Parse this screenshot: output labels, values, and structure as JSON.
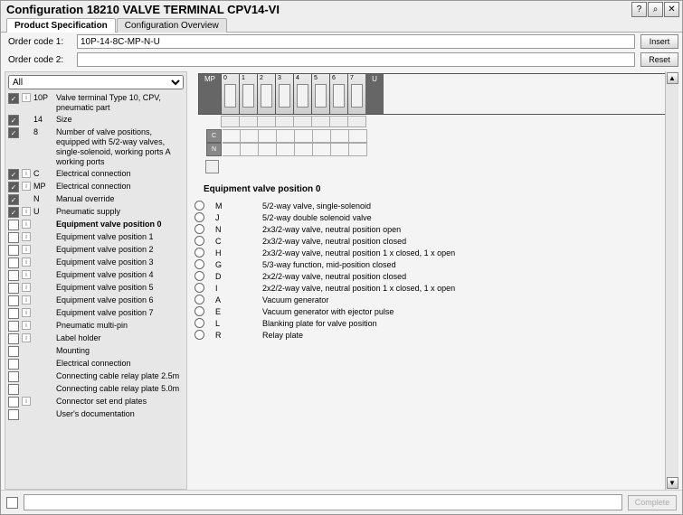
{
  "title": "Configuration 18210 VALVE TERMINAL CPV14-VI",
  "tabs": [
    "Product Specification",
    "Configuration Overview"
  ],
  "orderCode1Label": "Order code 1:",
  "orderCode1Value": "10P-14-8C-MP-N-U",
  "orderCode2Label": "Order code 2:",
  "insert": "Insert",
  "reset": "Reset",
  "filter": "All",
  "config": [
    {
      "ck": true,
      "info": true,
      "code": "10P",
      "lbl": "Valve terminal Type 10, CPV, pneumatic part"
    },
    {
      "ck": true,
      "info": false,
      "code": "14",
      "lbl": "Size"
    },
    {
      "ck": true,
      "info": false,
      "code": "8",
      "lbl": "Number of valve positions, equipped with 5/2-way valves, single-solenoid, working ports A working ports"
    },
    {
      "ck": true,
      "info": true,
      "code": "C",
      "lbl": "Electrical connection"
    },
    {
      "ck": true,
      "info": true,
      "code": "MP",
      "lbl": "Electrical connection"
    },
    {
      "ck": true,
      "info": false,
      "code": "N",
      "lbl": "Manual override"
    },
    {
      "ck": true,
      "info": true,
      "code": "U",
      "lbl": "Pneumatic supply"
    },
    {
      "ck": false,
      "info": true,
      "code": "",
      "lbl": "Equipment valve position 0",
      "bold": true
    },
    {
      "ck": false,
      "info": true,
      "code": "",
      "lbl": "Equipment valve position 1"
    },
    {
      "ck": false,
      "info": true,
      "code": "",
      "lbl": "Equipment valve position 2"
    },
    {
      "ck": false,
      "info": true,
      "code": "",
      "lbl": "Equipment valve position 3"
    },
    {
      "ck": false,
      "info": true,
      "code": "",
      "lbl": "Equipment valve position 4"
    },
    {
      "ck": false,
      "info": true,
      "code": "",
      "lbl": "Equipment valve position 5"
    },
    {
      "ck": false,
      "info": true,
      "code": "",
      "lbl": "Equipment valve position 6"
    },
    {
      "ck": false,
      "info": true,
      "code": "",
      "lbl": "Equipment valve position 7"
    },
    {
      "ck": false,
      "info": true,
      "code": "",
      "lbl": "Pneumatic multi-pin"
    },
    {
      "ck": false,
      "info": true,
      "code": "",
      "lbl": "Label holder"
    },
    {
      "ck": false,
      "info": false,
      "code": "",
      "lbl": "Mounting"
    },
    {
      "ck": false,
      "info": false,
      "code": "",
      "lbl": "Electrical connection"
    },
    {
      "ck": false,
      "info": false,
      "code": "",
      "lbl": "Connecting cable relay plate 2.5m"
    },
    {
      "ck": false,
      "info": false,
      "code": "",
      "lbl": "Connecting cable relay plate 5.0m"
    },
    {
      "ck": false,
      "info": true,
      "code": "",
      "lbl": "Connector set end plates"
    },
    {
      "ck": false,
      "info": false,
      "code": "",
      "lbl": "User's documentation"
    }
  ],
  "slots": [
    "0",
    "1",
    "2",
    "3",
    "4",
    "5",
    "6",
    "7"
  ],
  "mpLabel": "MP",
  "uLabel": "U",
  "cLabel": "C",
  "nLabel": "N",
  "sectionTitle": "Equipment valve position 0",
  "options": [
    {
      "code": "M",
      "desc": "5/2-way valve, single-solenoid"
    },
    {
      "code": "J",
      "desc": "5/2-way double solenoid valve"
    },
    {
      "code": "N",
      "desc": "2x3/2-way valve, neutral position open"
    },
    {
      "code": "C",
      "desc": "2x3/2-way valve, neutral position closed"
    },
    {
      "code": "H",
      "desc": "2x3/2-way valve, neutral position 1 x closed, 1 x open"
    },
    {
      "code": "G",
      "desc": "5/3-way function, mid-position closed"
    },
    {
      "code": "D",
      "desc": "2x2/2-way valve, neutral position closed"
    },
    {
      "code": "I",
      "desc": "2x2/2-way valve, neutral position 1 x closed, 1 x open"
    },
    {
      "code": "A",
      "desc": "Vacuum generator"
    },
    {
      "code": "E",
      "desc": "Vacuum generator with ejector pulse"
    },
    {
      "code": "L",
      "desc": "Blanking plate for valve position"
    },
    {
      "code": "R",
      "desc": "Relay plate"
    }
  ],
  "complete": "Complete"
}
